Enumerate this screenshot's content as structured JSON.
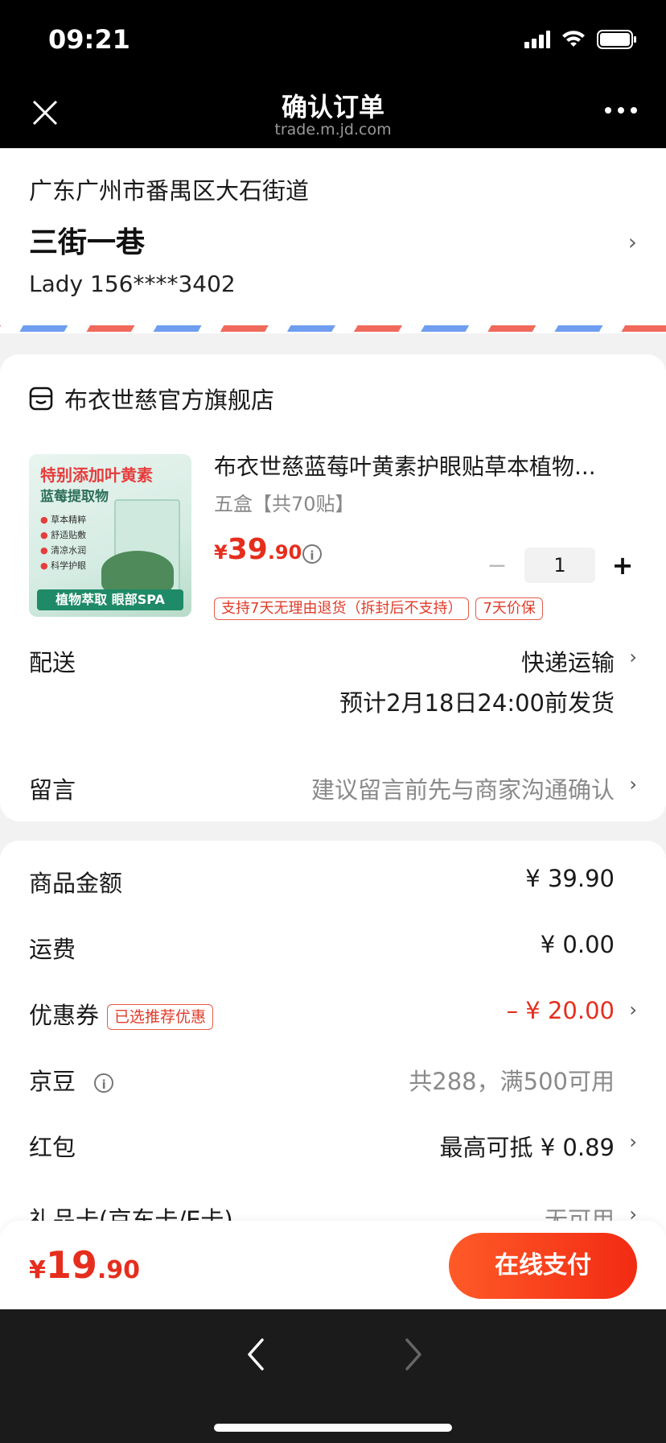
{
  "status": {
    "time": "09:21"
  },
  "header": {
    "title": "确认订单",
    "subtitle": "trade.m.jd.com"
  },
  "address": {
    "region": "广东广州市番禺区大石街道",
    "detail": "三街一巷",
    "contact": "Lady 156****3402"
  },
  "store": {
    "name": "布衣世慈官方旗舰店",
    "product": {
      "name": "布衣世慈蓝莓叶黄素护眼贴草本植物...",
      "variant": "五盒【共70贴】",
      "price_currency": "¥",
      "price_int": "39",
      "price_dec": ".90",
      "quantity": "1",
      "tags": [
        "支持7天无理由退货（拆封后不支持）",
        "7天价保"
      ],
      "image": {
        "headline": "特别添加叶黄素",
        "sub": "蓝莓提取物",
        "bullets": [
          "草本精粹",
          "舒适贴敷",
          "清凉水润",
          "科学护眼"
        ],
        "bar": "植物萃取 眼部SPA"
      }
    },
    "delivery": {
      "label": "配送",
      "method": "快递运输",
      "estimate": "预计2月18日24:00前发货"
    },
    "message": {
      "label": "留言",
      "placeholder": "建议留言前先与商家沟通确认"
    }
  },
  "summary": {
    "goods": {
      "label": "商品金额",
      "value": "¥ 39.90"
    },
    "shipping": {
      "label": "运费",
      "value": "¥ 0.00"
    },
    "coupon": {
      "label": "优惠券",
      "tag": "已选推荐优惠",
      "value": "– ¥ 20.00"
    },
    "jingdou": {
      "label": "京豆",
      "value": "共288，满500可用"
    },
    "hongbao": {
      "label": "红包",
      "value": "最高可抵 ¥ 0.89"
    },
    "giftcard": {
      "label": "礼品卡(京东卡/E卡)",
      "value": "无可用"
    }
  },
  "paybar": {
    "currency": "¥",
    "total_int": "19",
    "total_dec": ".90",
    "pay_label": "在线支付"
  },
  "colors": {
    "accent": "#e62e1e",
    "stripe_red": "#f06a5c",
    "stripe_blue": "#6f9ef0"
  }
}
